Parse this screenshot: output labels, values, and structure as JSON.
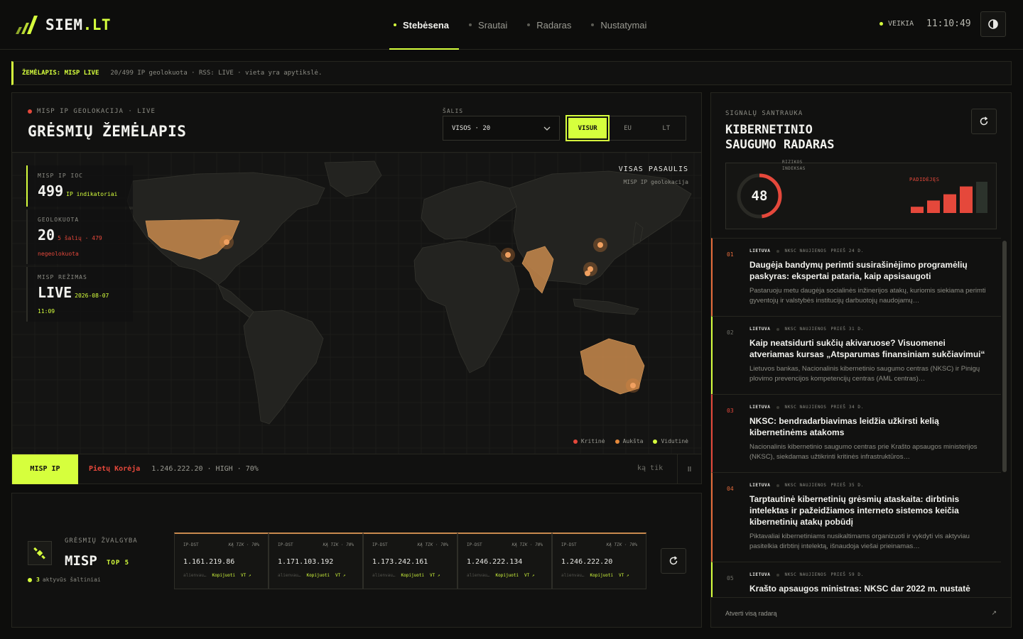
{
  "header": {
    "logo_text": "SIEM",
    "logo_tld": ".LT",
    "nav": [
      {
        "label": "Stebėsena",
        "active": true
      },
      {
        "label": "Srautai"
      },
      {
        "label": "Radaras"
      },
      {
        "label": "Nustatymai"
      }
    ],
    "status": "VEIKIA",
    "clock": "11:10:49",
    "theme_icon": "contrast-icon"
  },
  "ticker": {
    "label": "ŽEMĖLAPIS: MISP LIVE",
    "text": "20/499 IP geolokuota · RSS: LIVE · vieta yra apytikslė."
  },
  "map": {
    "eyebrow": "MISP IP GEOLOKACIJA · LIVE",
    "title": "GRĖSMIŲ ŽEMĖLAPIS",
    "country_label": "ŠALIS",
    "country_value": "VISOS · 20",
    "scope": [
      "VISUR",
      "EU",
      "LT"
    ],
    "scope_active": "VISUR",
    "world_title": "VISAS PASAULIS",
    "world_sub": "MISP IP geolokacija",
    "stats": {
      "ioc_label": "MISP IP IOC",
      "ioc_value": "499",
      "ioc_sub": "IP indikatoriai",
      "geo_label": "GEOLOKUOTA",
      "geo_value": "20",
      "geo_sub": "5 šalių · 479",
      "geo_sub2": "negeolokuota",
      "mode_label": "MISP REŽIMAS",
      "mode_value": "LIVE",
      "mode_date": "2026-08-07",
      "mode_time": "11:09"
    },
    "legend": [
      {
        "label": "Kritinė",
        "color": "#e5483b"
      },
      {
        "label": "Aukšta",
        "color": "#e5893b"
      },
      {
        "label": "Vidutinė",
        "color": "#d6ff3d"
      }
    ],
    "feed": {
      "tag": "MISP IP",
      "country": "Pietų Korėja",
      "info": "1.246.222.20 · HIGH · 70%",
      "time": "ką tik",
      "pause": "II"
    }
  },
  "intel": {
    "eyebrow": "GRĖSMIŲ ŽVALGYBA",
    "title": "MISP",
    "top": "TOP 5",
    "sources_count": "3",
    "sources_text": "aktyvūs šaltiniai",
    "cards": [
      {
        "type": "IP-DST",
        "when": "KĄ TIK · 70%",
        "ip": "1.161.219.86",
        "src": "alienvau…",
        "copy": "Kopijuoti",
        "vt": "VT ↗"
      },
      {
        "type": "IP-DST",
        "when": "KĄ TIK · 70%",
        "ip": "1.171.103.192",
        "src": "alienvau…",
        "copy": "Kopijuoti",
        "vt": "VT ↗"
      },
      {
        "type": "IP-DST",
        "when": "KĄ TIK · 70%",
        "ip": "1.173.242.161",
        "src": "alienvau…",
        "copy": "Kopijuoti",
        "vt": "VT ↗"
      },
      {
        "type": "IP-DST",
        "when": "KĄ TIK · 70%",
        "ip": "1.246.222.134",
        "src": "alienvau…",
        "copy": "Kopijuoti",
        "vt": "VT ↗"
      },
      {
        "type": "IP-DST",
        "when": "KĄ TIK · 70%",
        "ip": "1.246.222.20",
        "src": "alienvau…",
        "copy": "Kopijuoti",
        "vt": "VT ↗"
      }
    ]
  },
  "radar": {
    "eyebrow": "SIGNALŲ SANTRAUKA",
    "title_line1": "KIBERNETINIO",
    "title_line2": "SAUGUMO RADARAS",
    "risk_label_1": "RIZIKOS",
    "risk_label_2": "INDEKSAS",
    "risk_value": "48",
    "risk_fraction": 0.48,
    "risk_status": "PADIDĖJĘS",
    "risk_bar_levels": [
      0.2,
      0.4,
      0.6,
      0.85,
      1.0
    ],
    "news": [
      {
        "num": "01",
        "src": "LIETUVA",
        "tag": "NKSC NAUJIENOS",
        "age": "PRIEŠ 24 D.",
        "title": "Daugėja bandymų perimti susirašinėjimo programėlių paskyras: ekspertai pataria, kaip apsisaugoti",
        "desc": "Pastaruoju metu daugėja socialinės inžinerijos atakų, kuriomis siekiama perimti gyventojų ir valstybės institucijų darbuotojų naudojamų…"
      },
      {
        "num": "02",
        "src": "LIETUVA",
        "tag": "NKSC NAUJIENOS",
        "age": "PRIEŠ 31 D.",
        "title": "Kaip neatsidurti sukčių akivaruose? Visuomenei atveriamas kursas „Atsparumas finansiniam sukčiavimui“",
        "desc": "Lietuvos bankas, Nacionalinis kibernetinio saugumo centras (NKSC) ir Pinigų plovimo prevencijos kompetencijų centras (AML centras)…"
      },
      {
        "num": "03",
        "src": "LIETUVA",
        "tag": "NKSC NAUJIENOS",
        "age": "PRIEŠ 34 D.",
        "title": "NKSC: bendradarbiavimas leidžia užkirsti kelią kibernetinėms atakoms",
        "desc": "Nacionalinis kibernetinio saugumo centras prie Krašto apsaugos ministerijos (NKSC), siekdamas užtikrinti kritinės infrastruktūros…"
      },
      {
        "num": "04",
        "src": "LIETUVA",
        "tag": "NKSC NAUJIENOS",
        "age": "PRIEŠ 35 D.",
        "title": "Tarptautinė kibernetinių grėsmių ataskaita: dirbtinis intelektas ir pažeidžiamos interneto sistemos keičia kibernetinių atakų pobūdį",
        "desc": "Piktavaliai kibernetiniams nusikaltimams organizuoti ir vykdyti vis aktyviau pasitelkia dirbtinį intelektą, išnaudoja viešai prieinamas…"
      },
      {
        "num": "05",
        "src": "LIETUVA",
        "tag": "NKSC NAUJIENOS",
        "age": "PRIEŠ 59 D.",
        "title": "Krašto apsaugos ministras: NKSC dar 2022 m. nustatė",
        "desc": ""
      }
    ],
    "footer_link": "Atverti visą radarą",
    "footer_arrow": "↗"
  }
}
